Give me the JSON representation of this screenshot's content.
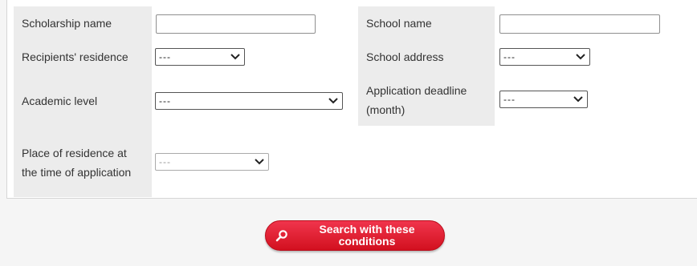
{
  "form": {
    "scholarship_name_label": "Scholarship name",
    "scholarship_name_value": "",
    "recipients_residence_label": "Recipients' residence",
    "recipients_residence_value": "---",
    "academic_level_label": "Academic level",
    "academic_level_value": "---",
    "place_of_residence_label": "Place of residence at the time of application",
    "place_of_residence_value": "---",
    "school_name_label": "School name",
    "school_name_value": "",
    "school_address_label": "School address",
    "school_address_value": "---",
    "application_deadline_label": "Application deadline (month)",
    "application_deadline_value": "---"
  },
  "search_button": {
    "label": "Search with these conditions",
    "icon": "search-icon"
  },
  "colors": {
    "accent": "#e0192d",
    "label_bg": "#ececec",
    "page_bg": "#f5f5f5"
  }
}
